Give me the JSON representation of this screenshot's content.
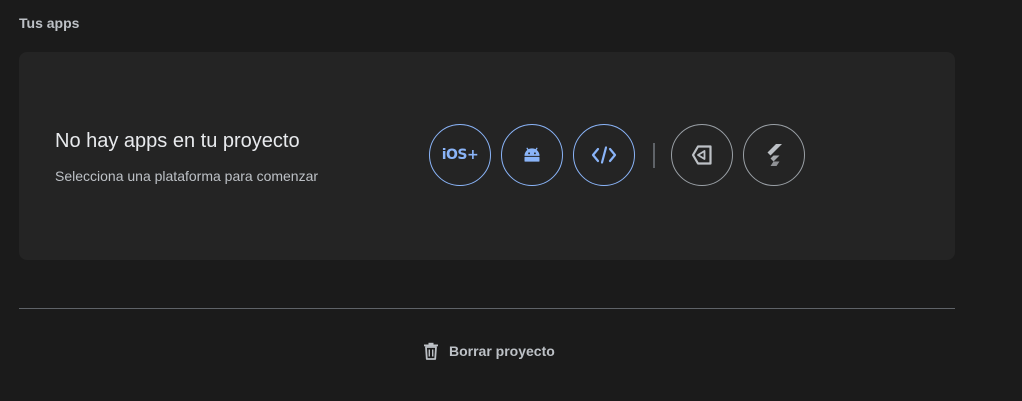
{
  "section": {
    "title": "Tus apps"
  },
  "empty_state": {
    "title": "No hay apps en tu proyecto",
    "subtitle": "Selecciona una plataforma para comenzar"
  },
  "platforms": [
    {
      "label": "iOS+",
      "icon": "ios-icon",
      "color": "#8ab4f8"
    },
    {
      "icon": "android-icon",
      "color": "#8ab4f8"
    },
    {
      "icon": "web-code-icon",
      "color": "#8ab4f8"
    },
    {
      "icon": "unity-icon",
      "color": "#bdc1c6"
    },
    {
      "icon": "flutter-icon",
      "color": "#bdc1c6"
    }
  ],
  "actions": {
    "delete_label": "Borrar proyecto",
    "delete_icon": "trash-icon"
  },
  "colors": {
    "background": "#1b1b1b",
    "card": "#242424",
    "accent": "#8ab4f8",
    "muted": "#bdc1c6"
  }
}
